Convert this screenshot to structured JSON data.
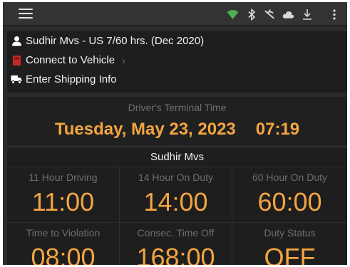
{
  "topbar": {
    "icons": [
      "menu-icon",
      "wifi-icon",
      "bluetooth-icon",
      "signal-off-icon",
      "cloud-icon",
      "download-icon",
      "more-vertical-icon"
    ],
    "colors": {
      "wifi": "#4caf50",
      "icons": "#d9d9d9"
    }
  },
  "info": {
    "driver": "Sudhir Mvs - US 7/60 hrs. (Dec 2020)",
    "vehicle": "Connect to Vehicle",
    "vehicle_chevron": "›",
    "shipping": "Enter Shipping Info"
  },
  "terminal": {
    "label": "Driver's Terminal Time",
    "date": "Tuesday, May 23, 2023",
    "time": "07:19"
  },
  "driver_panel": {
    "name": "Sudhir Mvs",
    "stats": [
      {
        "label": "11 Hour Driving",
        "value": "11:00"
      },
      {
        "label": "14 Hour On Duty",
        "value": "14:00"
      },
      {
        "label": "60 Hour On Duty",
        "value": "60:00"
      },
      {
        "label": "Time to Violation",
        "value": "08:00"
      },
      {
        "label": "Consec. Time Off",
        "value": "168:00"
      },
      {
        "label": "Duty Status",
        "value": "OFF"
      }
    ]
  },
  "colors": {
    "accent": "#f2a540",
    "muted": "#6e6e6e",
    "text": "#f2f2f2",
    "vehicle_icon": "#c62828"
  }
}
